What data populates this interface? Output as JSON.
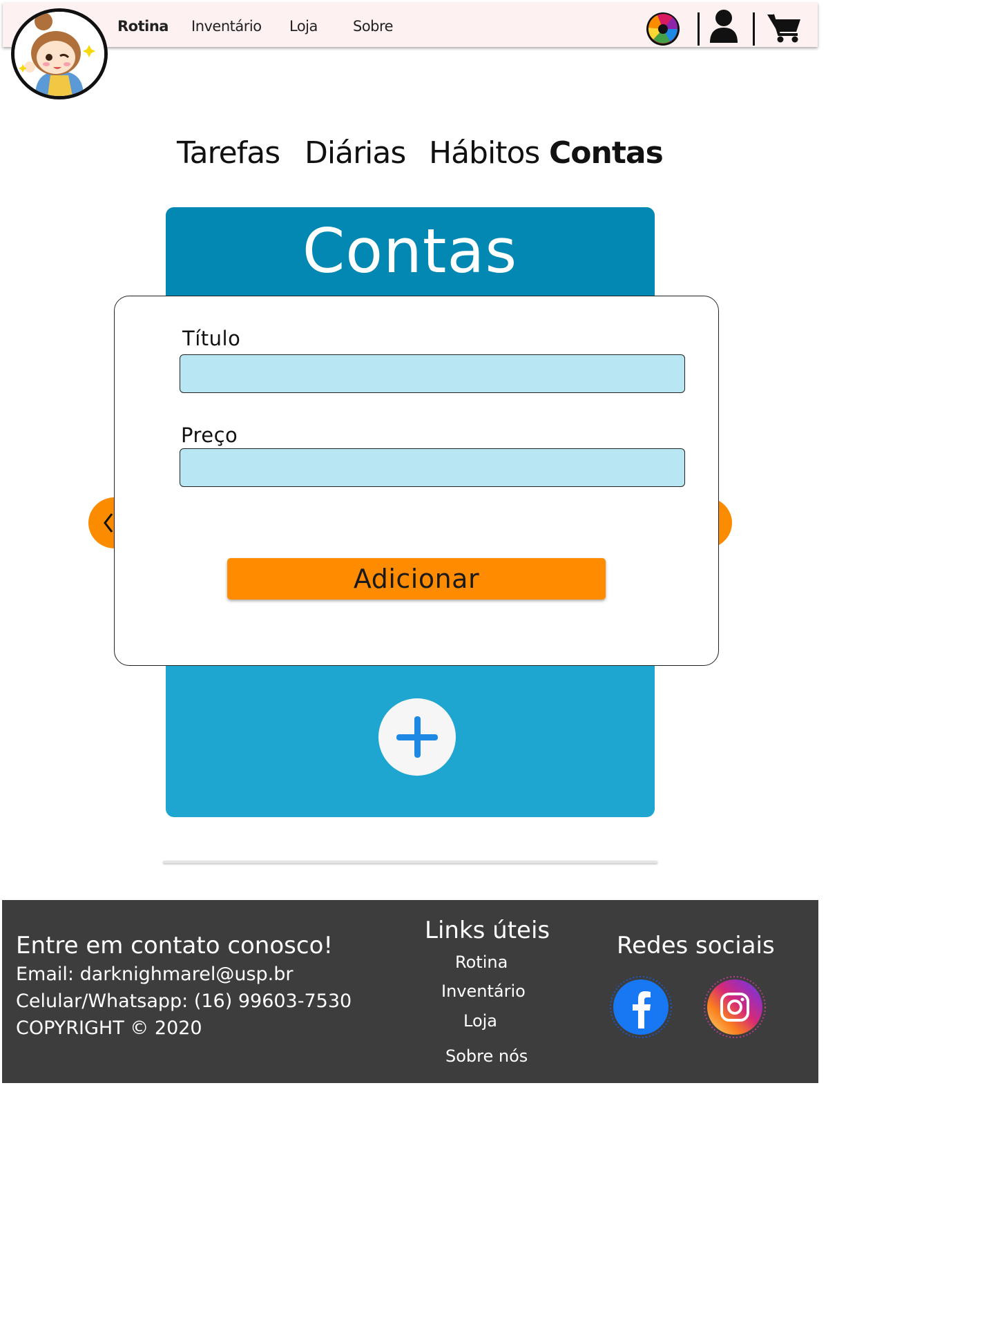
{
  "nav": {
    "links": [
      "Rotina",
      "Inventário",
      "Loja",
      "Sobre"
    ],
    "active": "Rotina"
  },
  "icons": {
    "theme": "color-wheel-icon",
    "profile": "user-icon",
    "cart": "cart-icon",
    "prev": "chevron-left-icon",
    "next": "chevron-right-icon",
    "add": "plus-icon",
    "facebook": "facebook-icon",
    "instagram": "instagram-icon"
  },
  "tabs": [
    "Tarefas",
    "Diárias",
    "Hábitos",
    "Contas"
  ],
  "active_tab": "Contas",
  "panel": {
    "title": "Contas"
  },
  "form": {
    "title_label": "Título",
    "title_value": "",
    "price_label": "Preço",
    "price_value": "",
    "submit_label": "Adicionar"
  },
  "footer": {
    "contact_heading": "Entre em contato conosco!",
    "email": "Email: darknighmarel@usp.br",
    "phone": "Celular/Whatsapp: (16) 99603-7530",
    "copyright": "COPYRIGHT © 2020",
    "links_heading": "Links úteis",
    "links": [
      "Rotina",
      "Inventário",
      "Loja",
      "Sobre nós"
    ],
    "social_heading": "Redes sociais"
  },
  "colors": {
    "panel_header": "#0288b3",
    "panel_body": "#1ea6d0",
    "input_bg": "#b8e6f3",
    "button": "#ff8b00",
    "footer_bg": "#3e3d3d",
    "topbar_bg": "#fdf1f1",
    "plus_icon": "#1e88e5"
  }
}
